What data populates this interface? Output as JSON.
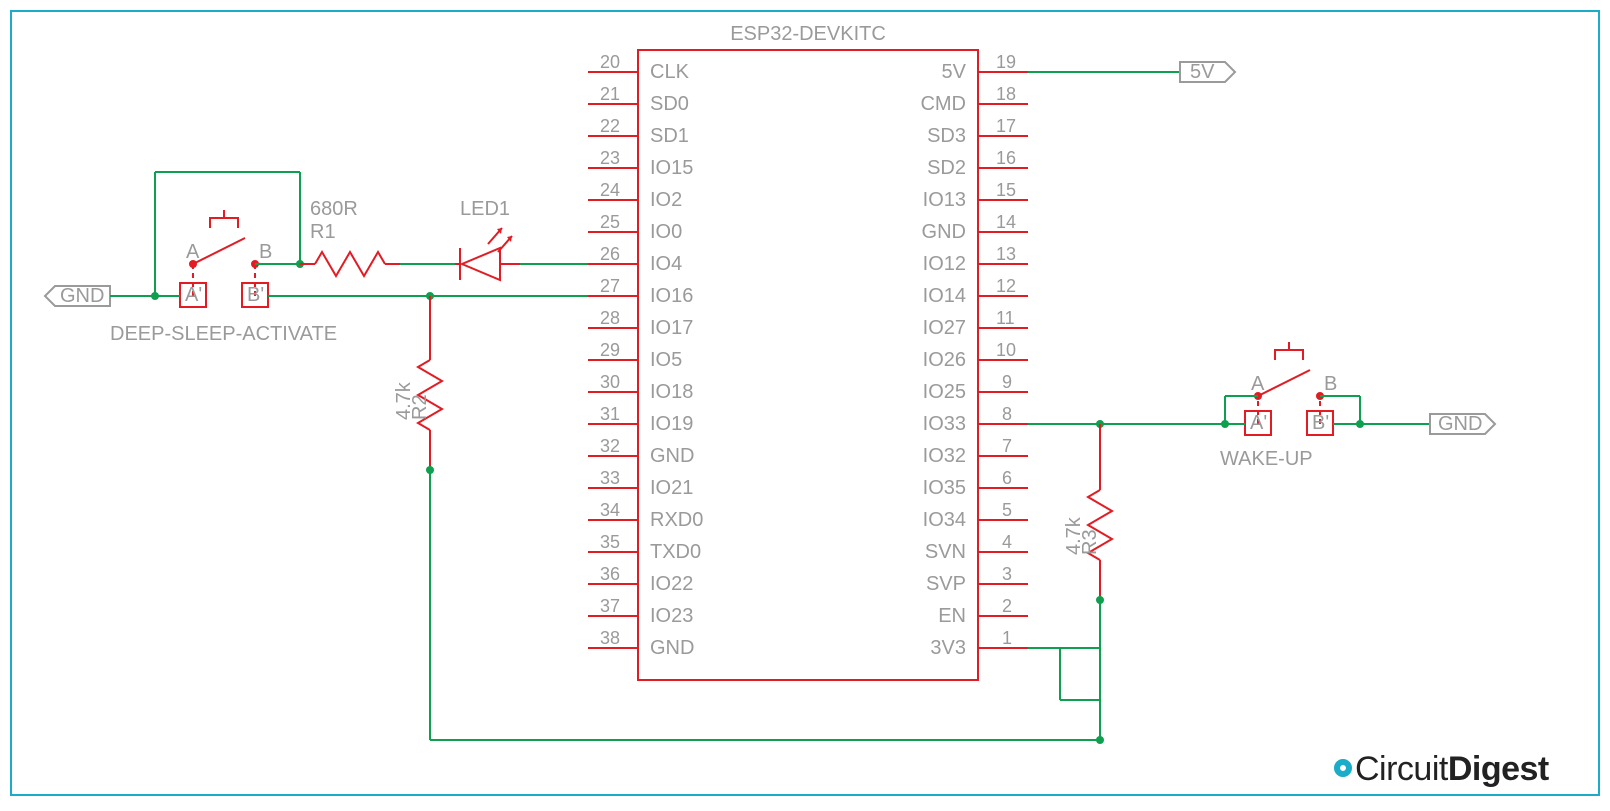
{
  "title": "ESP32-DEVKITC",
  "chip": {
    "left": [
      {
        "num": "20",
        "name": "CLK"
      },
      {
        "num": "21",
        "name": "SD0"
      },
      {
        "num": "22",
        "name": "SD1"
      },
      {
        "num": "23",
        "name": "IO15"
      },
      {
        "num": "24",
        "name": "IO2"
      },
      {
        "num": "25",
        "name": "IO0"
      },
      {
        "num": "26",
        "name": "IO4"
      },
      {
        "num": "27",
        "name": "IO16"
      },
      {
        "num": "28",
        "name": "IO17"
      },
      {
        "num": "29",
        "name": "IO5"
      },
      {
        "num": "30",
        "name": "IO18"
      },
      {
        "num": "31",
        "name": "IO19"
      },
      {
        "num": "32",
        "name": "GND"
      },
      {
        "num": "33",
        "name": "IO21"
      },
      {
        "num": "34",
        "name": "RXD0"
      },
      {
        "num": "35",
        "name": "TXD0"
      },
      {
        "num": "36",
        "name": "IO22"
      },
      {
        "num": "37",
        "name": "IO23"
      },
      {
        "num": "38",
        "name": "GND"
      }
    ],
    "right": [
      {
        "num": "19",
        "name": "5V"
      },
      {
        "num": "18",
        "name": "CMD"
      },
      {
        "num": "17",
        "name": "SD3"
      },
      {
        "num": "16",
        "name": "SD2"
      },
      {
        "num": "15",
        "name": "IO13"
      },
      {
        "num": "14",
        "name": "GND"
      },
      {
        "num": "13",
        "name": "IO12"
      },
      {
        "num": "12",
        "name": "IO14"
      },
      {
        "num": "11",
        "name": "IO27"
      },
      {
        "num": "10",
        "name": "IO26"
      },
      {
        "num": "9",
        "name": "IO25"
      },
      {
        "num": "8",
        "name": "IO33"
      },
      {
        "num": "7",
        "name": "IO32"
      },
      {
        "num": "6",
        "name": "IO35"
      },
      {
        "num": "5",
        "name": "IO34"
      },
      {
        "num": "4",
        "name": "SVN"
      },
      {
        "num": "3",
        "name": "SVP"
      },
      {
        "num": "2",
        "name": "EN"
      },
      {
        "num": "1",
        "name": "3V3"
      }
    ]
  },
  "components": {
    "r1": {
      "ref": "R1",
      "value": "680R"
    },
    "r2": {
      "ref": "R2",
      "value": "4.7k"
    },
    "r3": {
      "ref": "R3",
      "value": "4.7k"
    },
    "led1": {
      "ref": "LED1"
    },
    "sw1": {
      "label": "DEEP-SLEEP-ACTIVATE",
      "a": "A",
      "b": "B",
      "ap": "A'",
      "bp": "B'"
    },
    "sw2": {
      "label": "WAKE-UP",
      "a": "A",
      "b": "B",
      "ap": "A'",
      "bp": "B'"
    }
  },
  "nets": {
    "gnd_left": "GND",
    "gnd_right": "GND",
    "vcc": "5V"
  },
  "logo": {
    "t1": "Circuit",
    "t2": "Digest"
  }
}
